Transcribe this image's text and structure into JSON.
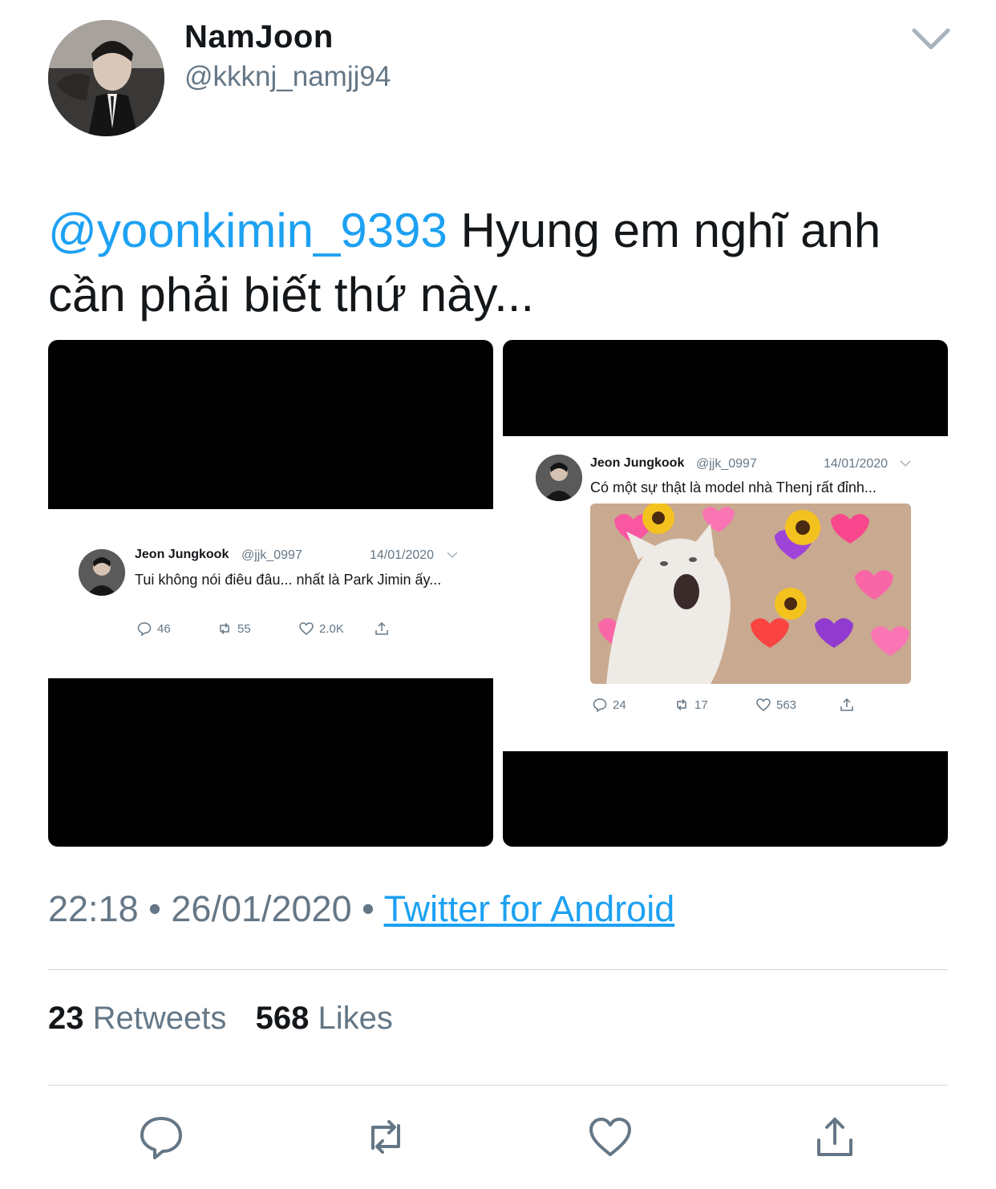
{
  "author": {
    "display_name": "NamJoon",
    "handle": "@kkknj_namjj94"
  },
  "tweet": {
    "mention": "@yoonkimin_9393",
    "text": " Hyung em nghĩ anh cần phải biết thứ này..."
  },
  "media": [
    {
      "name": "Jeon Jungkook",
      "handle": "@jjk_0997",
      "date": "14/01/2020",
      "text": "Tui không nói điêu đâu... nhất là Park Jimin ấy...",
      "replies": "46",
      "retweets": "55",
      "likes": "2.0K"
    },
    {
      "name": "Jeon Jungkook",
      "handle": "@jjk_0997",
      "date": "14/01/2020",
      "text": "Có một sự thật là model nhà Thenj rất đỉnh...",
      "replies": "24",
      "retweets": "17",
      "likes": "563"
    }
  ],
  "meta": {
    "time": "22:18",
    "date": "26/01/2020",
    "source": "Twitter for Android",
    "separator": " • "
  },
  "stats": {
    "retweets_count": "23",
    "retweets_label": "Retweets",
    "likes_count": "568",
    "likes_label": "Likes"
  },
  "icons": {
    "reply": "reply-icon",
    "retweet": "retweet-icon",
    "like": "heart-icon",
    "share": "share-icon",
    "caret": "chevron-down-icon"
  },
  "colors": {
    "accent": "#1da1f2",
    "secondary_text": "#657786",
    "primary_text": "#14171a"
  }
}
